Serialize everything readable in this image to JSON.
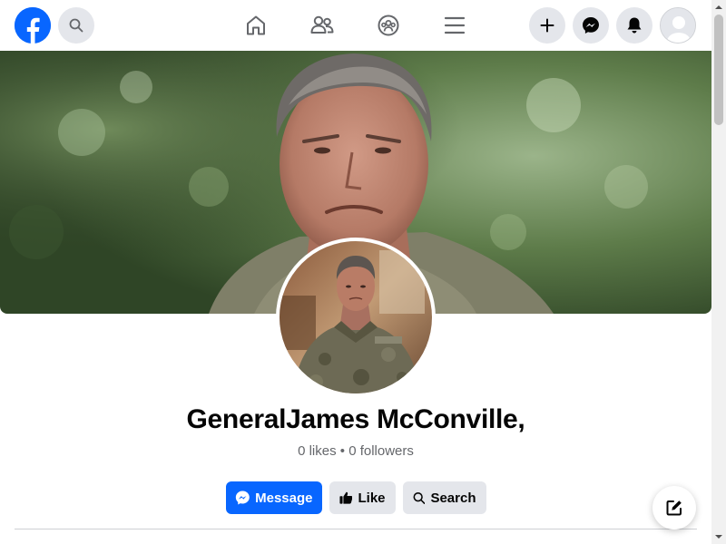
{
  "nav": {
    "logo_icon": "facebook-logo-icon",
    "search_icon": "search-icon",
    "center_icons": [
      "home-icon",
      "friends-icon",
      "groups-icon",
      "menu-icon"
    ],
    "right_icons": [
      "plus-icon",
      "messenger-icon",
      "bell-icon"
    ],
    "avatar_icon": "default-avatar-icon"
  },
  "profile": {
    "name": "GeneralJames McConville,",
    "stats": "0 likes • 0 followers"
  },
  "actions": {
    "message_label": "Message",
    "like_label": "Like",
    "search_label": "Search"
  },
  "colors": {
    "brand": "#0866ff",
    "secondary_button": "#e4e6eb",
    "text_primary": "#050505",
    "text_secondary": "#65676b"
  },
  "fab": {
    "icon": "compose-icon"
  }
}
